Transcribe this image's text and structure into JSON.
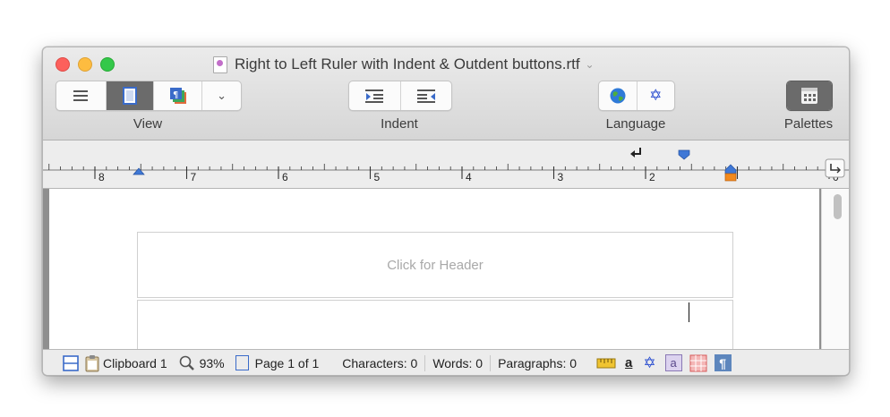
{
  "window": {
    "title": "Right to Left Ruler with Indent & Outdent buttons.rtf",
    "title_chevron": "⌄"
  },
  "toolbar": {
    "view_label": "View",
    "indent_label": "Indent",
    "language_label": "Language",
    "palettes_label": "Palettes",
    "view_chevron": "⌄",
    "hebrew_glyph": "✡"
  },
  "ruler": {
    "numbers": [
      "8",
      "7",
      "6",
      "5",
      "4",
      "3",
      "2",
      "0"
    ]
  },
  "document": {
    "header_placeholder": "Click for Header"
  },
  "status": {
    "clipboard": "Clipboard 1",
    "zoom": "93%",
    "page": "Page 1 of 1",
    "characters": "Characters: 0",
    "words": "Words: 0",
    "paragraphs": "Paragraphs: 0",
    "underline_a": "a",
    "hebrew_glyph": "✡",
    "boxed_a": "a",
    "pilcrow": "¶"
  },
  "colors": {
    "accent": "#3a6bc9",
    "marker_blue": "#3f78d6",
    "marker_orange": "#f28a1e"
  }
}
